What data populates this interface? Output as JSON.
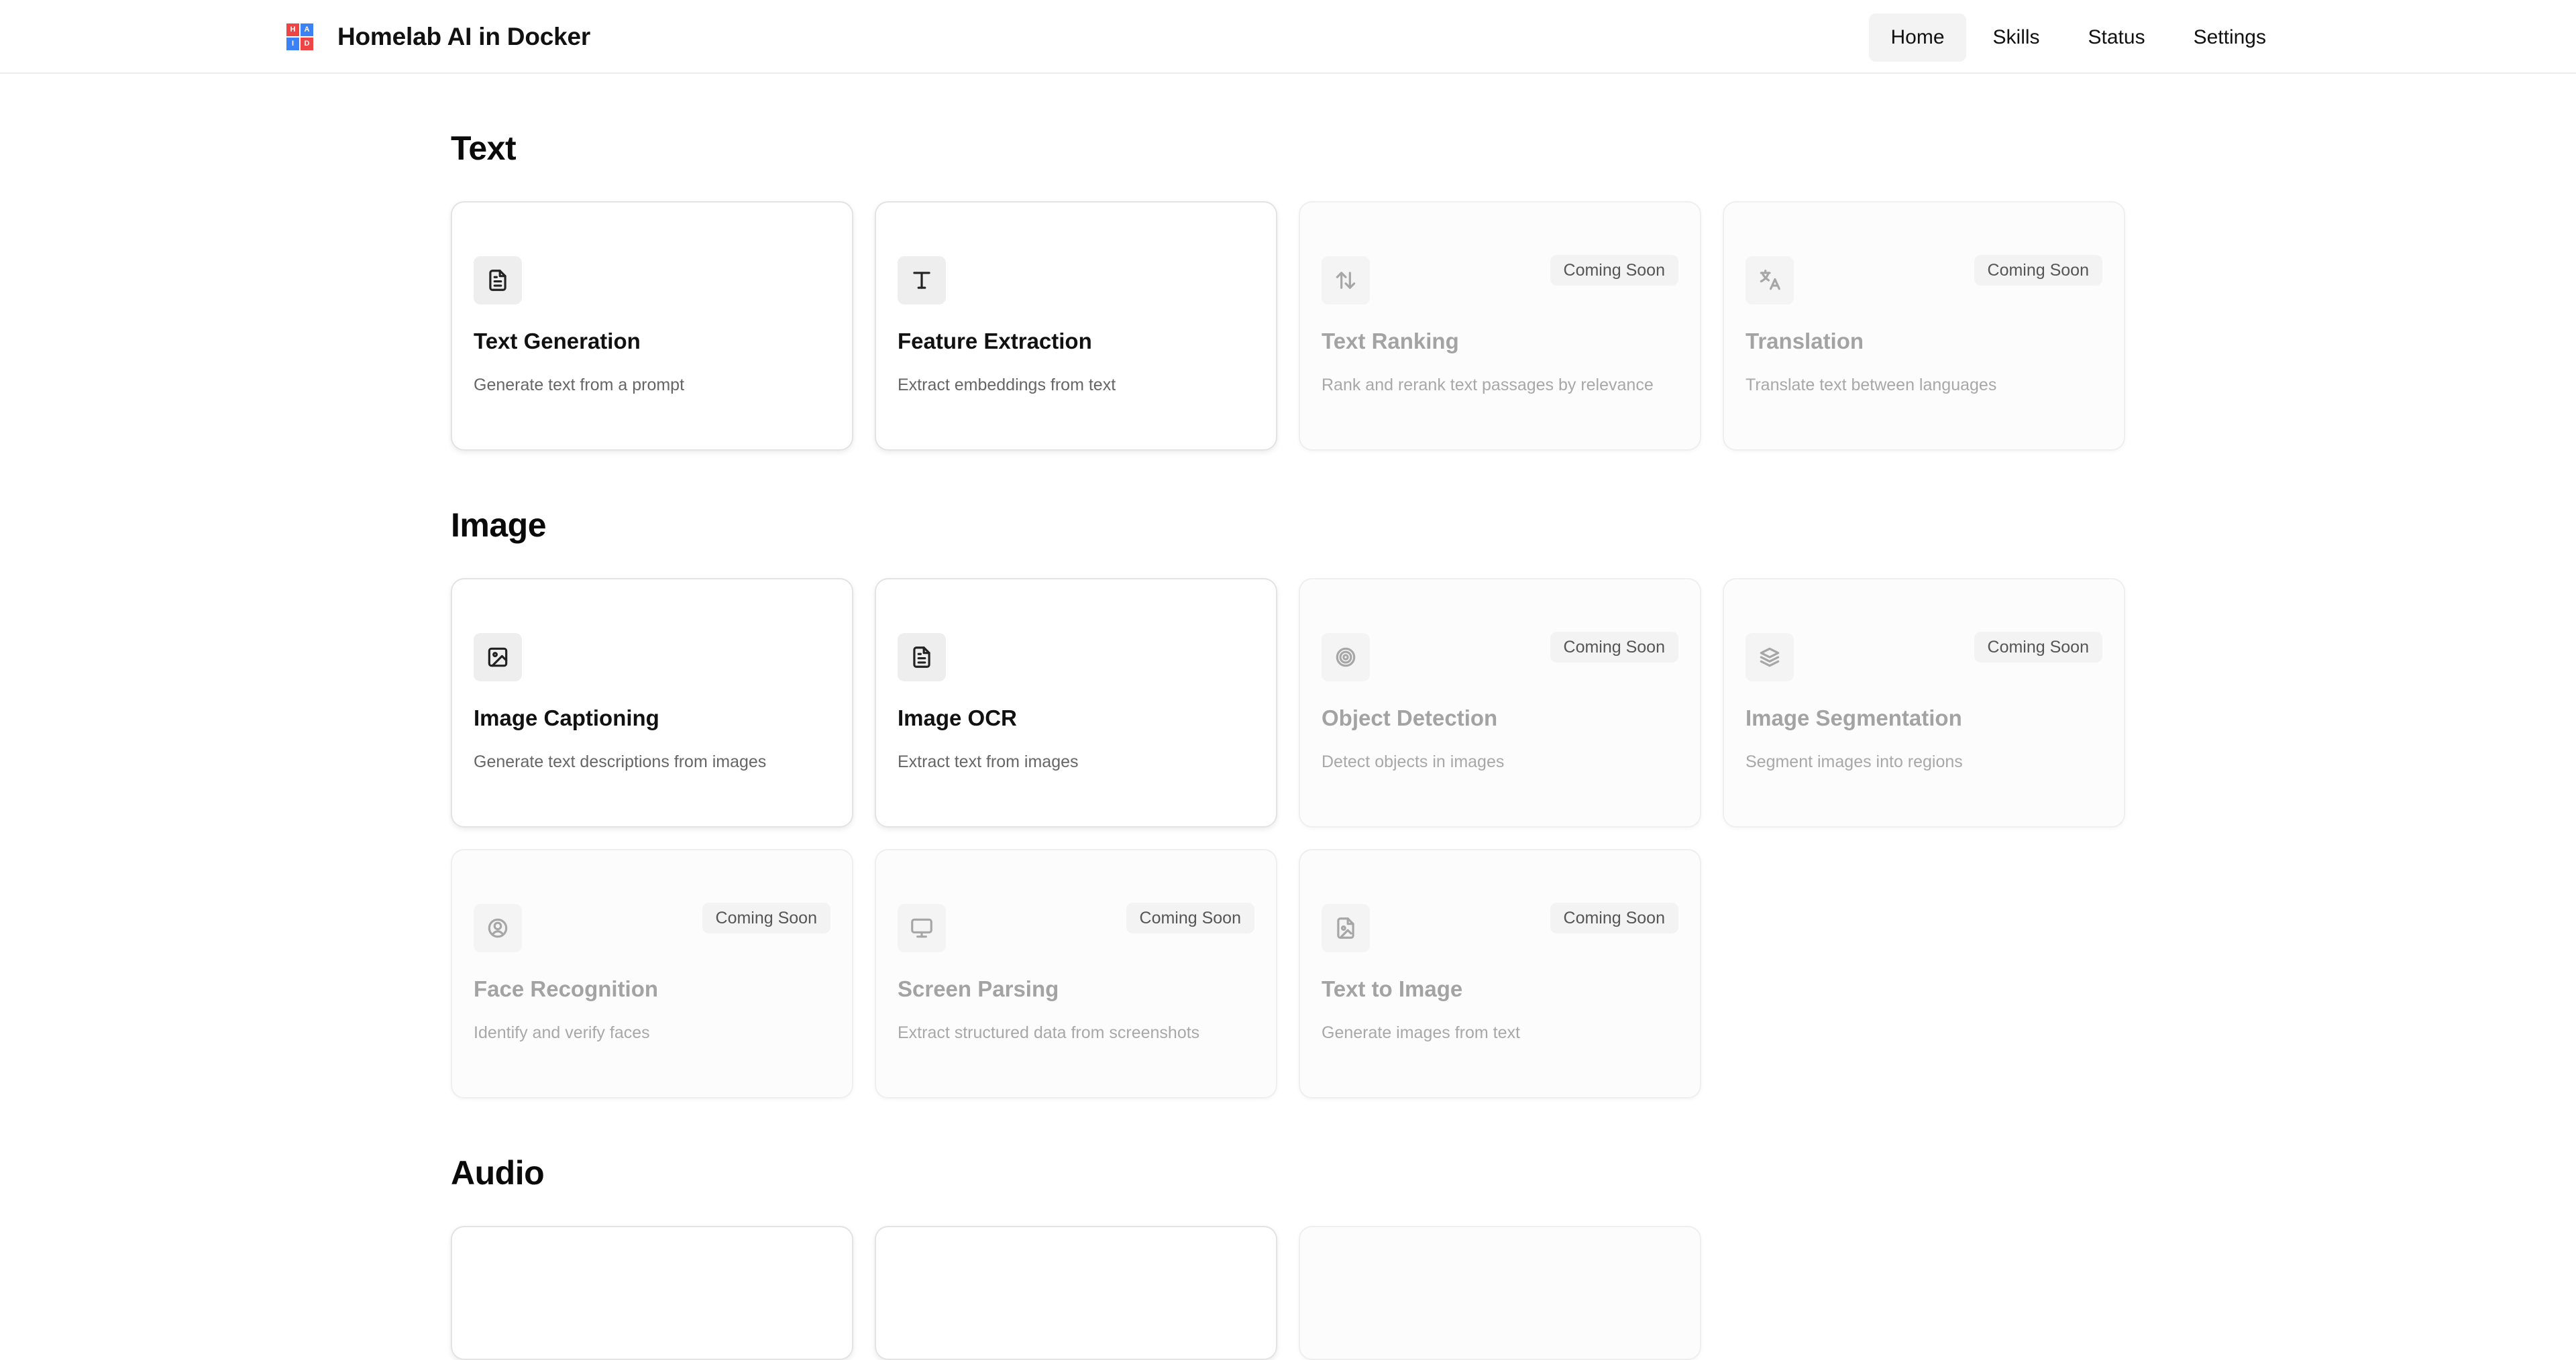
{
  "app": {
    "title": "Homelab AI in Docker",
    "logo_letters": [
      "H",
      "A",
      "I",
      "D"
    ]
  },
  "nav": [
    {
      "label": "Home",
      "active": true
    },
    {
      "label": "Skills",
      "active": false
    },
    {
      "label": "Status",
      "active": false
    },
    {
      "label": "Settings",
      "active": false
    }
  ],
  "sections": {
    "text": {
      "title": "Text",
      "cards": [
        {
          "title": "Text Generation",
          "desc": "Generate text from a prompt",
          "icon": "document-icon",
          "soon": false
        },
        {
          "title": "Feature Extraction",
          "desc": "Extract embeddings from text",
          "icon": "type-icon",
          "soon": false
        },
        {
          "title": "Text Ranking",
          "desc": "Rank and rerank text passages by relevance",
          "icon": "arrow-up-down-icon",
          "soon": true,
          "badge": "Coming Soon"
        },
        {
          "title": "Translation",
          "desc": "Translate text between languages",
          "icon": "languages-icon",
          "soon": true,
          "badge": "Coming Soon"
        }
      ]
    },
    "image": {
      "title": "Image",
      "cards": [
        {
          "title": "Image Captioning",
          "desc": "Generate text descriptions from images",
          "icon": "image-icon",
          "soon": false
        },
        {
          "title": "Image OCR",
          "desc": "Extract text from images",
          "icon": "document-icon",
          "soon": false
        },
        {
          "title": "Object Detection",
          "desc": "Detect objects in images",
          "icon": "target-icon",
          "soon": true,
          "badge": "Coming Soon"
        },
        {
          "title": "Image Segmentation",
          "desc": "Segment images into regions",
          "icon": "layers-icon",
          "soon": true,
          "badge": "Coming Soon"
        },
        {
          "title": "Face Recognition",
          "desc": "Identify and verify faces",
          "icon": "user-circle-icon",
          "soon": true,
          "badge": "Coming Soon"
        },
        {
          "title": "Screen Parsing",
          "desc": "Extract structured data from screenshots",
          "icon": "monitor-icon",
          "soon": true,
          "badge": "Coming Soon"
        },
        {
          "title": "Text to Image",
          "desc": "Generate images from text",
          "icon": "file-image-icon",
          "soon": true,
          "badge": "Coming Soon"
        }
      ]
    },
    "audio": {
      "title": "Audio"
    }
  }
}
